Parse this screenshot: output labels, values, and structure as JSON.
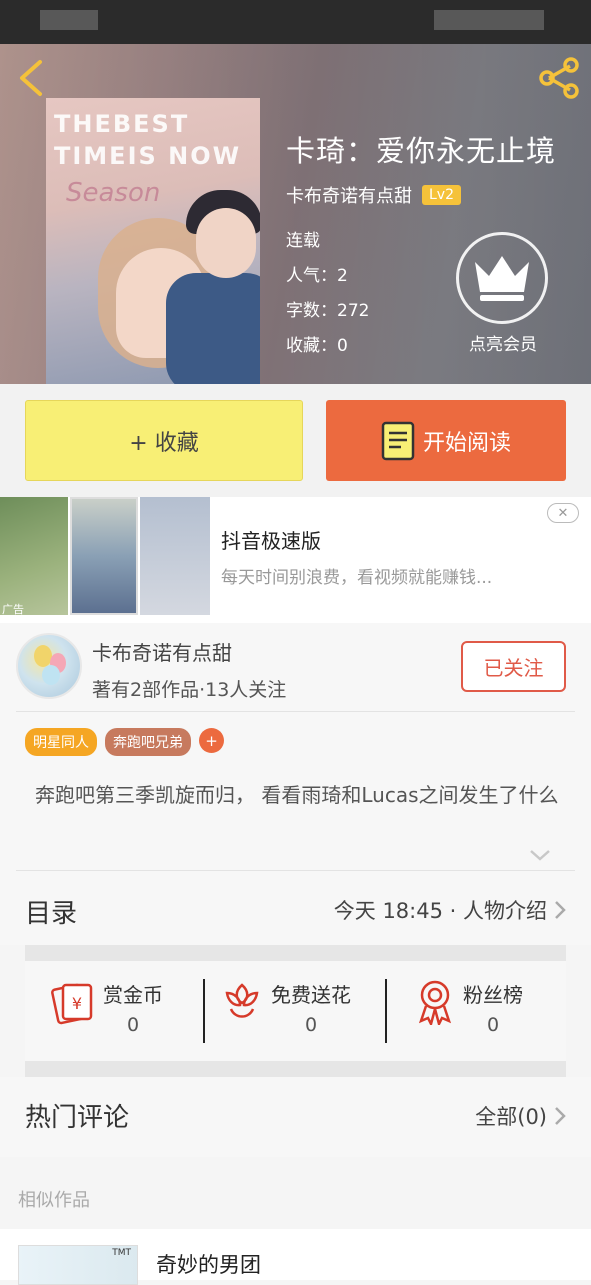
{
  "book": {
    "title": "卡琦：爱你永无止境",
    "author": "卡布奇诺有点甜",
    "level": "Lv2",
    "status": "连载",
    "popularity": "人气：2",
    "word_count": "字数：272",
    "favorites": "收藏：0",
    "vip_label": "点亮会员",
    "cover_text": "THEBEST TIMEIS NOW"
  },
  "actions": {
    "favorite_label": "+ 收藏",
    "read_label": "开始阅读"
  },
  "ad": {
    "title": "抖音极速版",
    "description": "每天时间别浪费，看视频就能赚钱...",
    "tag": "广告",
    "close": "✕"
  },
  "author_card": {
    "name": "卡布奇诺有点甜",
    "stats": "著有2部作品·13人关注",
    "follow_label": "已关注"
  },
  "tags": [
    {
      "label": "明星同人",
      "color": "#f5a623"
    },
    {
      "label": "奔跑吧兄弟",
      "color": "#c77a5e"
    }
  ],
  "tag_add": "+",
  "synopsis": "奔跑吧第三季凯旋而归， 看看雨琦和Lucas之间发生了什么",
  "catalog": {
    "title": "目录",
    "latest": "今天 18:45 · 人物介绍"
  },
  "gifts": [
    {
      "label": "赏金币",
      "value": "0",
      "icon": "coin-envelope-icon"
    },
    {
      "label": "免费送花",
      "value": "0",
      "icon": "flower-icon"
    },
    {
      "label": "粉丝榜",
      "value": "0",
      "icon": "medal-icon"
    }
  ],
  "comments": {
    "title": "热门评论",
    "all_label": "全部(0)"
  },
  "similar": {
    "heading": "相似作品",
    "first_title": "奇妙的男团",
    "thumb_badge": "TMT"
  },
  "colors": {
    "accent_orange": "#ec6a3f",
    "favorite_yellow": "#f8ef75",
    "level_badge": "#f5c23a",
    "follow_red": "#e05a48"
  }
}
